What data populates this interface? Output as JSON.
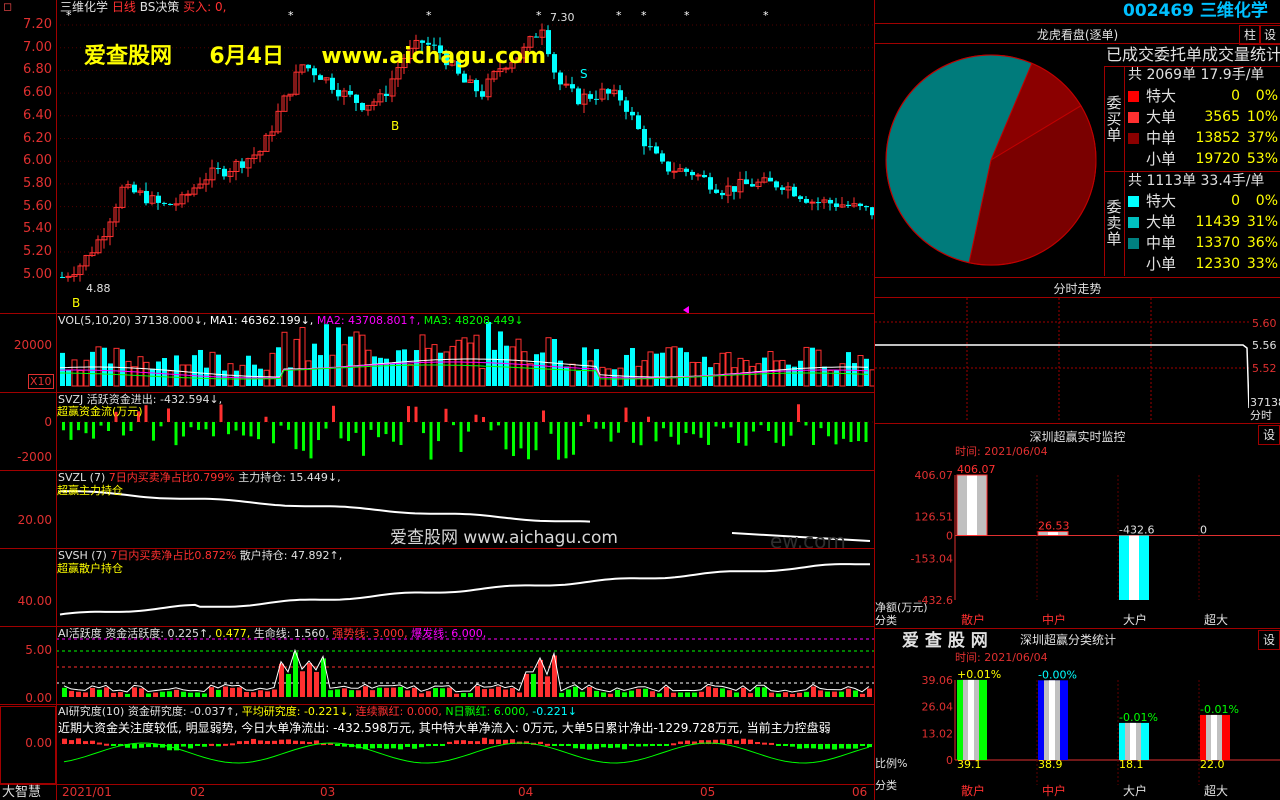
{
  "stock": {
    "code": "002469",
    "name": "三维化学"
  },
  "header": {
    "title": "三维化学",
    "period": "日线",
    "strategy": "BS决策",
    "buy_label": "买入: 0,"
  },
  "watermark": {
    "site": "爱查股网",
    "date": "6月4日",
    "url": "www.aichagu.com",
    "center": "爱查股网  www.aichagu.com",
    "ghost": "ew.com"
  },
  "price_axis": [
    "7.20",
    "7.00",
    "6.80",
    "6.60",
    "6.40",
    "6.20",
    "6.00",
    "5.80",
    "5.60",
    "5.40",
    "5.20",
    "5.00"
  ],
  "price_annotations": {
    "low": "4.88",
    "high": "7.30",
    "buy1": "B",
    "buy2": "B",
    "sell": "S"
  },
  "vol": {
    "label": "VOL(5,10,20)",
    "value": "37138.000↓,",
    "ma1": "MA1: 46362.199↓,",
    "ma2": "MA2: 43708.801↑,",
    "ma3": "MA3: 48208.449↓",
    "axis": "20000",
    "unit": "X10"
  },
  "svzj": {
    "label": "SVZJ",
    "text": "活跃资金进出: -432.594↓,",
    "sub": "超赢资金流(万元)",
    "axis0": "0",
    "axis1": "-2000"
  },
  "svzl": {
    "label": "SVZL (7)",
    "text1": "7日内买卖净占比0.799%",
    "text2": "主力持仓: 15.449↓,",
    "sub": "超赢主力持仓",
    "axis": "20.00"
  },
  "svsh": {
    "label": "SVSH (7)",
    "text1": "7日内买卖净占比0.872%",
    "text2": "散户持仓: 47.892↑,",
    "sub": "超赢散户持仓",
    "axis": "40.00"
  },
  "ai_hy": {
    "label": "AI活跃度",
    "t1": "资金活跃度: 0.225↑,",
    "t2": "0.477,",
    "t3": "生命线: 1.560,",
    "t4": "强势线: 3.000,",
    "t5": "爆发线: 6.000,",
    "axis_top": "5.00",
    "axis_bot": "0.00"
  },
  "ai_yj": {
    "label": "AI研究度(10)",
    "t1": "资金研究度: -0.037↑,",
    "t2": "平均研究度: -0.221↓,",
    "t3": "连续飘红: 0.000,",
    "t4": "N日飘红: 6.000,",
    "t5": "-0.221↓",
    "note": "近期大资金关注度较低, 明显弱势, 今日大单净流出: -432.598万元, 其中特大单净流入: 0万元, 大单5日累计净出-1229.728万元, 当前主力控盘弱",
    "axis": "0.00"
  },
  "date_axis": [
    "2021/01",
    "02",
    "03",
    "04",
    "05",
    "06"
  ],
  "brand": "大智慧",
  "right": {
    "btn_zhu": "柱",
    "btn_shezhi": "设",
    "lhb_title": "龙虎看盘(逐单)",
    "stats_title": "已成交委托单成交量统计",
    "buy": {
      "side": "委买单",
      "total": "共 2069单 17.9手/单",
      "rows": [
        {
          "label": "特大",
          "val": "0",
          "pct": "0%"
        },
        {
          "label": "大单",
          "val": "3565",
          "pct": "10%"
        },
        {
          "label": "中单",
          "val": "13852",
          "pct": "37%"
        },
        {
          "label": "小单",
          "val": "19720",
          "pct": "53%"
        }
      ]
    },
    "sell": {
      "side": "委卖单",
      "total": "共 1113单 33.4手/单",
      "rows": [
        {
          "label": "特大",
          "val": "0",
          "pct": "0%"
        },
        {
          "label": "大单",
          "val": "11439",
          "pct": "31%"
        },
        {
          "label": "中单",
          "val": "13370",
          "pct": "36%"
        },
        {
          "label": "小单",
          "val": "12330",
          "pct": "33%"
        }
      ]
    },
    "fenshi": {
      "title": "分时走势",
      "p1": "5.60",
      "p2": "5.56",
      "p3": "5.52",
      "vol": "37138",
      "unit": "分时"
    },
    "monitor": {
      "title": "深圳超赢实时监控",
      "time": "时间: 2021/06/04",
      "axis": [
        "406.07",
        "126.51",
        "0",
        "-153.04",
        "-432.6"
      ],
      "ylabel": "净额(万元)",
      "xlabel": "分类",
      "bars": [
        {
          "cat": "散户",
          "val": "406.07"
        },
        {
          "cat": "中户",
          "val": "26.53"
        },
        {
          "cat": "大户",
          "val": "-432.6"
        },
        {
          "cat": "超大",
          "val": "0"
        }
      ]
    },
    "classify": {
      "brand": "爱 查 股 网",
      "title": "深圳超赢分类统计",
      "time": "时间: 2021/06/04",
      "axis": [
        "39.06",
        "26.04",
        "13.02",
        "0"
      ],
      "ylabel": "比例%",
      "xlabel": "分类",
      "bars": [
        {
          "cat": "散户",
          "val": "39.1",
          "chg": "+0.01%"
        },
        {
          "cat": "中户",
          "val": "38.9",
          "chg": "-0.00%"
        },
        {
          "cat": "大户",
          "val": "18.1",
          "chg": "-0.01%"
        },
        {
          "cat": "超大",
          "val": "22.0",
          "chg": "-0.01%"
        }
      ]
    }
  },
  "chart_data": [
    {
      "type": "pie",
      "title": "龙虎看盘(逐单)",
      "slices": [
        {
          "name": "特大",
          "value": 0
        },
        {
          "name": "大单",
          "value": 10
        },
        {
          "name": "中单",
          "value": 37
        },
        {
          "name": "小单",
          "value": 53
        }
      ]
    },
    {
      "type": "bar",
      "title": "深圳超赢实时监控",
      "categories": [
        "散户",
        "中户",
        "大户",
        "超大"
      ],
      "values": [
        406.07,
        26.53,
        -432.6,
        0
      ],
      "ylim": [
        -432.6,
        406.07
      ]
    },
    {
      "type": "bar",
      "title": "深圳超赢分类统计",
      "categories": [
        "散户",
        "中户",
        "大户",
        "超大"
      ],
      "values": [
        39.1,
        38.9,
        18.1,
        22.0
      ],
      "ylim": [
        0,
        39.06
      ]
    },
    {
      "type": "line",
      "title": "分时走势",
      "y": [
        5.56,
        5.56,
        5.56,
        5.56,
        5.56,
        5.56,
        5.48
      ],
      "ylim": [
        5.48,
        5.62
      ]
    }
  ],
  "colors": {
    "up": "#ff3030",
    "down": "#00ffff",
    "panel_border": "#a00000",
    "yellow": "#ffff00",
    "magenta": "#ff00ff",
    "green": "#00ff00"
  }
}
